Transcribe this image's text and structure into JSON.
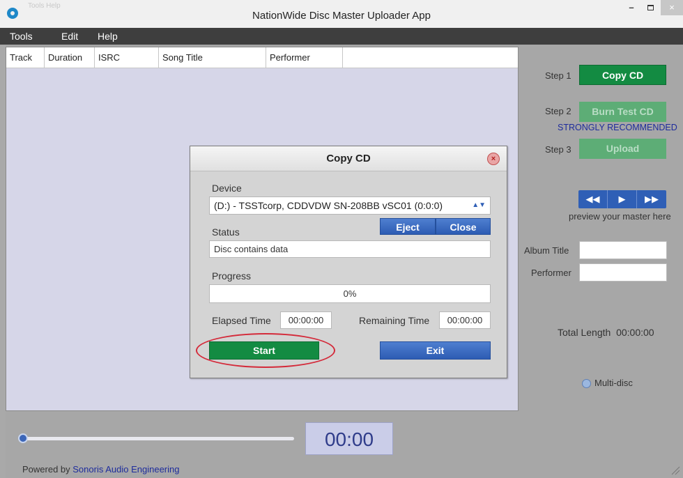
{
  "window": {
    "faint_title": "Tools  Help",
    "title": "NationWide Disc Master Uploader App",
    "minimize": "–",
    "close": "×"
  },
  "menu": [
    "Tools",
    "Edit",
    "Help"
  ],
  "tracklist": {
    "columns": [
      "Track",
      "Duration",
      "ISRC",
      "Song Title",
      "Performer"
    ]
  },
  "steps": [
    {
      "label": "Step 1",
      "button": "Copy CD",
      "state": "active"
    },
    {
      "label": "Step 2",
      "button": "Burn Test CD",
      "state": "disabled"
    },
    {
      "label": "Step 3",
      "button": "Upload",
      "state": "disabled"
    }
  ],
  "recommend_text": "STRONGLY RECOMMENDED",
  "transport": {
    "rewind": "◀◀",
    "play": "▶",
    "forward": "▶▶"
  },
  "preview_text": "preview your master here",
  "album_title_label": "Album Title",
  "performer_label": "Performer",
  "total_length_label": "Total Length",
  "total_length_value": "00:00:00",
  "multidisc_label": "Multi-disc",
  "time_display": "00:00",
  "powered": {
    "prefix": "Powered by ",
    "link": "Sonoris Audio Engineering"
  },
  "dialog": {
    "title": "Copy CD",
    "close_icon": "×",
    "device_label": "Device",
    "device_value": "(D:) - TSSTcorp, CDDVDW SN-208BB  vSC01 (0:0:0)",
    "device_arrows": "▲▼",
    "eject": "Eject",
    "close": "Close",
    "status_label": "Status",
    "status_value": "Disc contains data",
    "progress_label": "Progress",
    "progress_value": "0%",
    "elapsed_label": "Elapsed Time",
    "elapsed_value": "00:00:00",
    "remaining_label": "Remaining Time",
    "remaining_value": "00:00:00",
    "start": "Start",
    "exit": "Exit"
  },
  "colors": {
    "accent_green": "#138b42",
    "accent_blue": "#2f5fb6",
    "recommend_text": "#1e2c9c",
    "annotation_ring": "#d42a3a"
  }
}
